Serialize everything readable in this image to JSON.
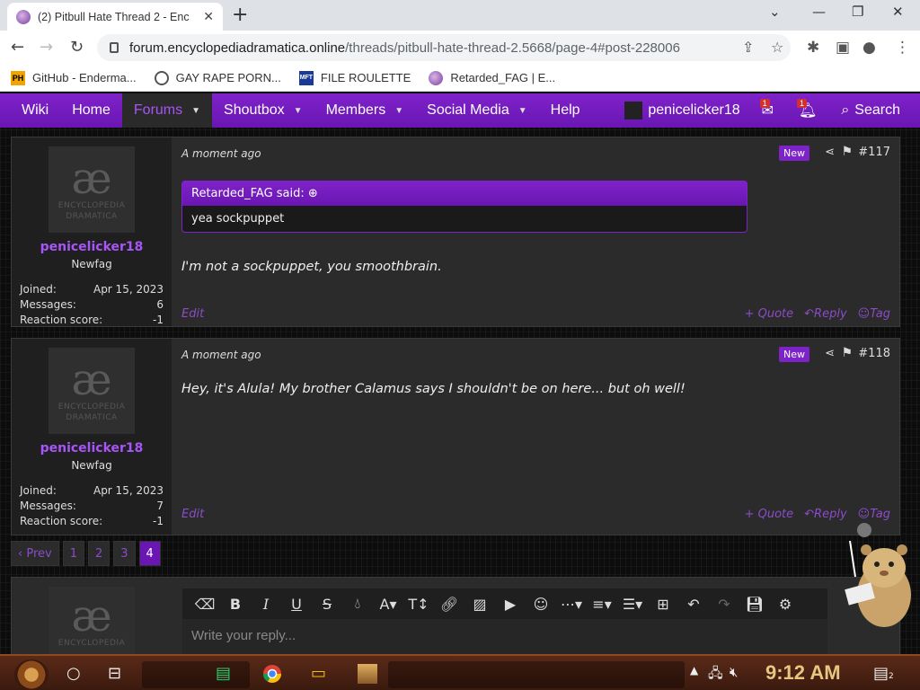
{
  "browser": {
    "tab_title": "(2) Pitbull Hate Thread 2 - Enc",
    "url_host": "forum.encyclopediadramatica.online",
    "url_path": "/threads/pitbull-hate-thread-2.5668/page-4#post-228006",
    "bookmarks": [
      {
        "label": "GitHub - Enderma...",
        "icon": "PH"
      },
      {
        "label": "GAY RAPE PORN...",
        "icon": "globe-icon"
      },
      {
        "label": "FILE ROULETTE",
        "icon": "MFT"
      },
      {
        "label": "Retarded_FAG | E...",
        "icon": "ed-icon"
      }
    ]
  },
  "nav": {
    "items": [
      "Wiki",
      "Home",
      "Forums",
      "Shoutbox",
      "Members",
      "Social Media",
      "Help"
    ],
    "active": "Forums",
    "username": "penicelicker18",
    "inbox_count": "1",
    "alert_count": "1",
    "search_label": "Search"
  },
  "posts": [
    {
      "user": "penicelicker18",
      "user_title": "Newfag",
      "joined_label": "Joined:",
      "joined": "Apr 15, 2023",
      "messages_label": "Messages:",
      "messages": "6",
      "reaction_label": "Reaction score:",
      "reaction": "-1",
      "time": "A moment ago",
      "new": "New",
      "number": "#117",
      "quote_author": "Retarded_FAG said:",
      "quote_text": "yea sockpuppet",
      "body": "I'm not a sockpuppet, you smoothbrain.",
      "edit": "Edit",
      "quote_btn": "+ Quote",
      "reply_btn": "Reply",
      "tag_btn": "Tag"
    },
    {
      "user": "penicelicker18",
      "user_title": "Newfag",
      "joined_label": "Joined:",
      "joined": "Apr 15, 2023",
      "messages_label": "Messages:",
      "messages": "7",
      "reaction_label": "Reaction score:",
      "reaction": "-1",
      "time": "A moment ago",
      "new": "New",
      "number": "#118",
      "body": "Hey, it's Alula! My brother Calamus says I shouldn't be on here... but oh well!",
      "edit": "Edit",
      "quote_btn": "+ Quote",
      "reply_btn": "Reply",
      "tag_btn": "Tag"
    }
  ],
  "avatar_text": {
    "glyph": "æ",
    "line1": "ENCYCLOPEDIA",
    "line2": "DRAMATICA"
  },
  "pager": {
    "prev": "‹ Prev",
    "pages": [
      "1",
      "2",
      "3",
      "4"
    ],
    "current": "4"
  },
  "reply": {
    "placeholder": "Write your reply..."
  },
  "taskbar": {
    "time": "9:12 AM",
    "notif_count": "2"
  }
}
